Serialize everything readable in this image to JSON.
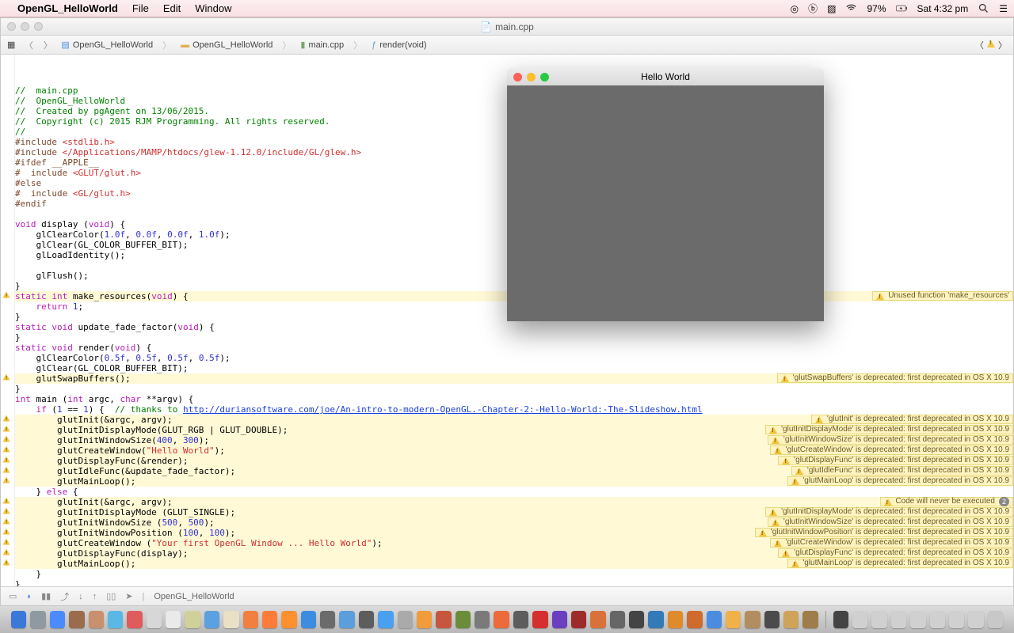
{
  "menubar": {
    "appname": "OpenGL_HelloWorld",
    "items": [
      "File",
      "Edit",
      "Window"
    ],
    "battery": "97%",
    "clock": "Sat 4:32 pm"
  },
  "window": {
    "filename": "main.cpp",
    "breadcrumbs": [
      "OpenGL_HelloWorld",
      "OpenGL_HelloWorld",
      "main.cpp",
      "render(void)"
    ]
  },
  "glwindow": {
    "title": "Hello World"
  },
  "bottom": {
    "target": "OpenGL_HelloWorld"
  },
  "code": [
    {
      "t": "//  main.cpp",
      "cls": "c-com"
    },
    {
      "t": "//  OpenGL_HelloWorld",
      "cls": "c-com"
    },
    {
      "t": "//  Created by pgAgent on 13/06/2015.",
      "cls": "c-com"
    },
    {
      "t": "//  Copyright (c) 2015 RJM Programming. All rights reserved.",
      "cls": "c-com"
    },
    {
      "t": "//",
      "cls": "c-com"
    },
    {
      "seg": [
        {
          "t": "#include ",
          "c": "c-pp"
        },
        {
          "t": "<stdlib.h>",
          "c": "c-inc"
        }
      ]
    },
    {
      "seg": [
        {
          "t": "#include ",
          "c": "c-pp"
        },
        {
          "t": "</Applications/MAMP/htdocs/glew-1.12.0/include/GL/glew.h>",
          "c": "c-inc"
        }
      ]
    },
    {
      "t": "#ifdef __APPLE__",
      "cls": "c-pp"
    },
    {
      "seg": [
        {
          "t": "#  include ",
          "c": "c-pp"
        },
        {
          "t": "<GLUT/glut.h>",
          "c": "c-inc"
        }
      ]
    },
    {
      "t": "#else",
      "cls": "c-pp"
    },
    {
      "seg": [
        {
          "t": "#  include ",
          "c": "c-pp"
        },
        {
          "t": "<GL/glut.h>",
          "c": "c-inc"
        }
      ]
    },
    {
      "t": "#endif",
      "cls": "c-pp"
    },
    {
      "t": ""
    },
    {
      "seg": [
        {
          "t": "void",
          "c": "c-kw"
        },
        {
          "t": " display ("
        },
        {
          "t": "void",
          "c": "c-kw"
        },
        {
          "t": ") {"
        }
      ]
    },
    {
      "seg": [
        {
          "t": "    glClearColor("
        },
        {
          "t": "1.0f",
          "c": "c-num"
        },
        {
          "t": ", "
        },
        {
          "t": "0.0f",
          "c": "c-num"
        },
        {
          "t": ", "
        },
        {
          "t": "0.0f",
          "c": "c-num"
        },
        {
          "t": ", "
        },
        {
          "t": "1.0f",
          "c": "c-num"
        },
        {
          "t": ");"
        }
      ]
    },
    {
      "t": "    glClear(GL_COLOR_BUFFER_BIT);"
    },
    {
      "t": "    glLoadIdentity();"
    },
    {
      "t": ""
    },
    {
      "t": "    glFlush();"
    },
    {
      "t": "}"
    },
    {
      "hl": true,
      "gw": true,
      "seg": [
        {
          "t": "static",
          "c": "c-kw"
        },
        {
          "t": " "
        },
        {
          "t": "int",
          "c": "c-ty"
        },
        {
          "t": " make_resources("
        },
        {
          "t": "void",
          "c": "c-kw"
        },
        {
          "t": ") {"
        }
      ],
      "diag": "Unused function 'make_resources'"
    },
    {
      "seg": [
        {
          "t": "    "
        },
        {
          "t": "return",
          "c": "c-kw"
        },
        {
          "t": " "
        },
        {
          "t": "1",
          "c": "c-num"
        },
        {
          "t": ";"
        }
      ]
    },
    {
      "t": "}"
    },
    {
      "seg": [
        {
          "t": "static",
          "c": "c-kw"
        },
        {
          "t": " "
        },
        {
          "t": "void",
          "c": "c-kw"
        },
        {
          "t": " update_fade_factor("
        },
        {
          "t": "void",
          "c": "c-kw"
        },
        {
          "t": ") {"
        }
      ]
    },
    {
      "t": "}"
    },
    {
      "seg": [
        {
          "t": "static",
          "c": "c-kw"
        },
        {
          "t": " "
        },
        {
          "t": "void",
          "c": "c-kw"
        },
        {
          "t": " render("
        },
        {
          "t": "void",
          "c": "c-kw"
        },
        {
          "t": ") {"
        }
      ]
    },
    {
      "seg": [
        {
          "t": "    glClearColor("
        },
        {
          "t": "0.5f",
          "c": "c-num"
        },
        {
          "t": ", "
        },
        {
          "t": "0.5f",
          "c": "c-num"
        },
        {
          "t": ", "
        },
        {
          "t": "0.5f",
          "c": "c-num"
        },
        {
          "t": ", "
        },
        {
          "t": "0.5f",
          "c": "c-num"
        },
        {
          "t": ");"
        }
      ]
    },
    {
      "t": "    glClear(GL_COLOR_BUFFER_BIT);"
    },
    {
      "hl": true,
      "gw": true,
      "t": "    glutSwapBuffers();",
      "diag": "'glutSwapBuffers' is deprecated: first deprecated in OS X 10.9"
    },
    {
      "t": "}"
    },
    {
      "seg": [
        {
          "t": "int",
          "c": "c-ty"
        },
        {
          "t": " main ("
        },
        {
          "t": "int",
          "c": "c-ty"
        },
        {
          "t": " argc, "
        },
        {
          "t": "char",
          "c": "c-ty"
        },
        {
          "t": " **argv) {"
        }
      ]
    },
    {
      "seg": [
        {
          "t": "    "
        },
        {
          "t": "if",
          "c": "c-kw"
        },
        {
          "t": " ("
        },
        {
          "t": "1",
          "c": "c-num"
        },
        {
          "t": " == "
        },
        {
          "t": "1",
          "c": "c-num"
        },
        {
          "t": ") {  "
        },
        {
          "t": "// thanks to ",
          "c": "c-com"
        },
        {
          "t": "http://duriansoftware.com/joe/An-intro-to-modern-OpenGL.-Chapter-2:-Hello-World:-The-Slideshow.html",
          "c": "c-url"
        }
      ]
    },
    {
      "hl": true,
      "gw": true,
      "t": "        glutInit(&argc, argv);",
      "diag": "'glutInit' is deprecated: first deprecated in OS X 10.9"
    },
    {
      "hl": true,
      "gw": true,
      "t": "        glutInitDisplayMode(GLUT_RGB | GLUT_DOUBLE);",
      "diag": "'glutInitDisplayMode' is deprecated: first deprecated in OS X 10.9"
    },
    {
      "hl": true,
      "gw": true,
      "seg": [
        {
          "t": "        glutInitWindowSize("
        },
        {
          "t": "400",
          "c": "c-num"
        },
        {
          "t": ", "
        },
        {
          "t": "300",
          "c": "c-num"
        },
        {
          "t": ");"
        }
      ],
      "diag": "'glutInitWindowSize' is deprecated: first deprecated in OS X 10.9"
    },
    {
      "hl": true,
      "gw": true,
      "seg": [
        {
          "t": "        glutCreateWindow("
        },
        {
          "t": "\"Hello World\"",
          "c": "c-str"
        },
        {
          "t": ");"
        }
      ],
      "diag": "'glutCreateWindow' is deprecated: first deprecated in OS X 10.9"
    },
    {
      "hl": true,
      "gw": true,
      "t": "        glutDisplayFunc(&render);",
      "diag": "'glutDisplayFunc' is deprecated: first deprecated in OS X 10.9"
    },
    {
      "hl": true,
      "gw": true,
      "t": "        glutIdleFunc(&update_fade_factor);",
      "diag": "'glutIdleFunc' is deprecated: first deprecated in OS X 10.9"
    },
    {
      "hl": true,
      "gw": true,
      "t": "        glutMainLoop();",
      "diag": "'glutMainLoop' is deprecated: first deprecated in OS X 10.9"
    },
    {
      "seg": [
        {
          "t": "    } "
        },
        {
          "t": "else",
          "c": "c-kw"
        },
        {
          "t": " {"
        }
      ]
    },
    {
      "hl": true,
      "gw": true,
      "t": "        glutInit(&argc, argv);",
      "diag": "Code will never be executed",
      "badge": "2"
    },
    {
      "hl": true,
      "gw": true,
      "t": "        glutInitDisplayMode (GLUT_SINGLE);",
      "diag": "'glutInitDisplayMode' is deprecated: first deprecated in OS X 10.9"
    },
    {
      "hl": true,
      "gw": true,
      "seg": [
        {
          "t": "        glutInitWindowSize ("
        },
        {
          "t": "500",
          "c": "c-num"
        },
        {
          "t": ", "
        },
        {
          "t": "500",
          "c": "c-num"
        },
        {
          "t": ");"
        }
      ],
      "diag": "'glutInitWindowSize' is deprecated: first deprecated in OS X 10.9"
    },
    {
      "hl": true,
      "gw": true,
      "seg": [
        {
          "t": "        glutInitWindowPosition ("
        },
        {
          "t": "100",
          "c": "c-num"
        },
        {
          "t": ", "
        },
        {
          "t": "100",
          "c": "c-num"
        },
        {
          "t": ");"
        }
      ],
      "diag": "'glutInitWindowPosition' is deprecated: first deprecated in OS X 10.9"
    },
    {
      "hl": true,
      "gw": true,
      "seg": [
        {
          "t": "        glutCreateWindow ("
        },
        {
          "t": "\"Your first OpenGL Window ... Hello World\"",
          "c": "c-str"
        },
        {
          "t": ");"
        }
      ],
      "diag": "'glutCreateWindow' is deprecated: first deprecated in OS X 10.9"
    },
    {
      "hl": true,
      "gw": true,
      "t": "        glutDisplayFunc(display);",
      "diag": "'glutDisplayFunc' is deprecated: first deprecated in OS X 10.9"
    },
    {
      "hl": true,
      "gw": true,
      "t": "        glutMainLoop();",
      "diag": "'glutMainLoop' is deprecated: first deprecated in OS X 10.9"
    },
    {
      "t": "    }"
    },
    {
      "t": "}"
    }
  ],
  "dock_colors": [
    "#3b78d8",
    "#8e9aa0",
    "#4b8bff",
    "#9c6b4b",
    "#c8906c",
    "#5ab8e6",
    "#e05b5b",
    "#d7d7d7",
    "#eaeaea",
    "#d0d09a",
    "#5da0e0",
    "#e9e0c6",
    "#f08040",
    "#ff7b3a",
    "#ff9030",
    "#3c8de0",
    "#6b6b6b",
    "#5a9edb",
    "#5d5d5d",
    "#4aa0f0",
    "#aaaaaa",
    "#f29b3b",
    "#c6563e",
    "#6b8d39",
    "#7a7a7a",
    "#ec6a3c",
    "#5d5d5d",
    "#d62f2f",
    "#6b40c0",
    "#9e2b2b",
    "#d9723a",
    "#666666",
    "#444444",
    "#337ab7",
    "#e08b2b",
    "#cf6b2d",
    "#4a8de0",
    "#efb24a",
    "#b28d5f",
    "#4b4b4b",
    "#cfa359",
    "#9f7d4a",
    "#444444",
    "#d0d0d0",
    "#d0d0d0",
    "#d0d0d0",
    "#d0d0d0",
    "#d0d0d0",
    "#d0d0d0",
    "#d0d0d0",
    "#c8c8c8"
  ]
}
